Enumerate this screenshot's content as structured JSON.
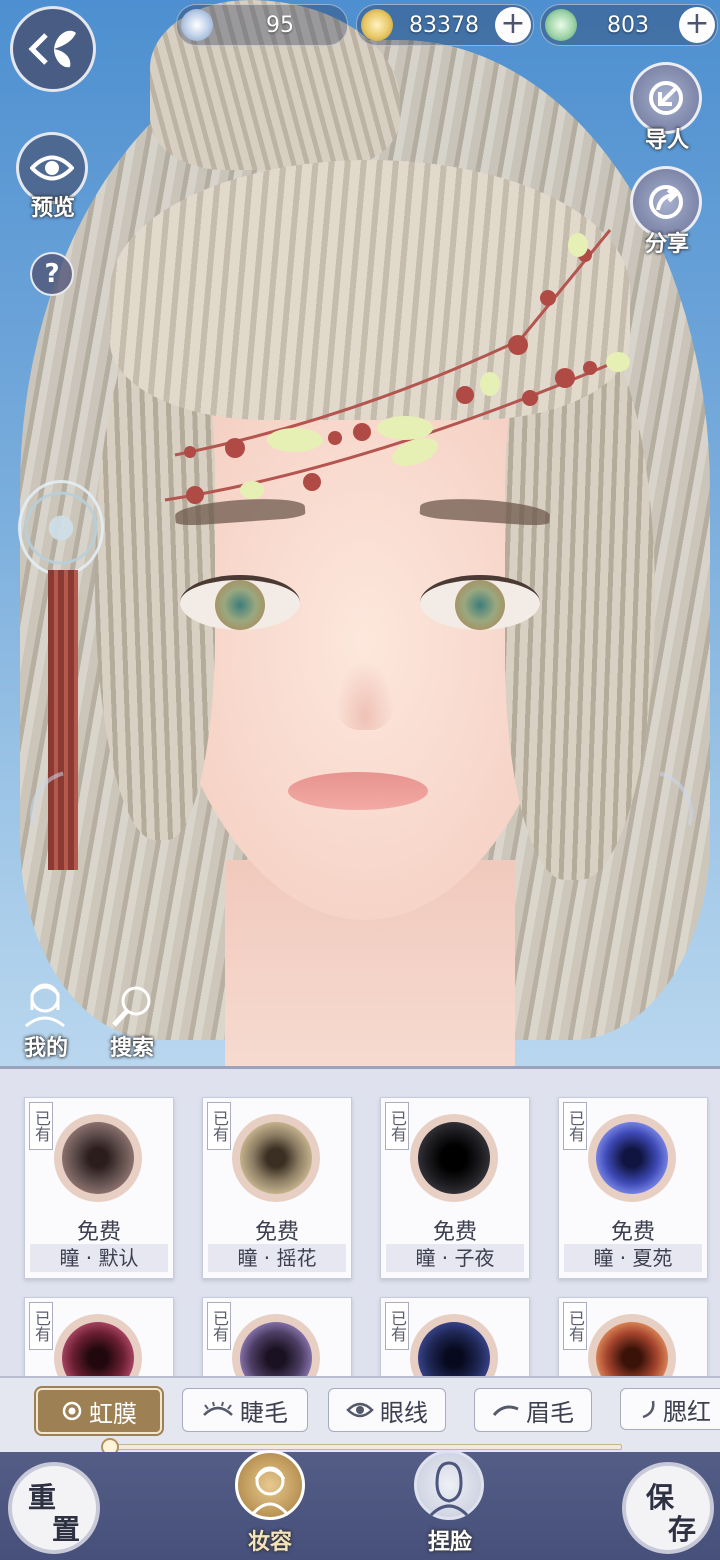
{
  "currencies": [
    {
      "name": "jade",
      "value": "95",
      "has_plus": false,
      "color": "#b9cce6"
    },
    {
      "name": "copper-coin",
      "value": "83378",
      "has_plus": true,
      "color": "#e8c766"
    },
    {
      "name": "token",
      "value": "803",
      "has_plus": true,
      "color": "#9fd4a8"
    }
  ],
  "plus_symbol": "+",
  "left_buttons": {
    "preview": "预览",
    "help_symbol": "?"
  },
  "right_buttons": {
    "import": "导人",
    "share": "分享"
  },
  "bottom_left": {
    "mine": "我的",
    "search": "搜索"
  },
  "items": [
    {
      "tag": "已有",
      "price": "免费",
      "name": "瞳 · 默认",
      "color": "#5a4a48"
    },
    {
      "tag": "已有",
      "price": "免费",
      "name": "瞳 · 摇花",
      "color": "#8a7b63"
    },
    {
      "tag": "已有",
      "price": "免费",
      "name": "瞳 · 子夜",
      "color": "#1e1e22"
    },
    {
      "tag": "已有",
      "price": "免费",
      "name": "瞳 · 夏苑",
      "color": "#3e49b5"
    },
    {
      "tag": "已有",
      "price": "",
      "name": "",
      "color": "#6b1f32"
    },
    {
      "tag": "已有",
      "price": "",
      "name": "",
      "color": "#4c3d63"
    },
    {
      "tag": "已有",
      "price": "",
      "name": "",
      "color": "#1f2755"
    },
    {
      "tag": "已有",
      "price": "",
      "name": "",
      "color": "#a6452e"
    }
  ],
  "tabs": [
    {
      "label": "虹膜",
      "icon": "circle-icon",
      "active": true
    },
    {
      "label": "睫毛",
      "icon": "lash-icon",
      "active": false
    },
    {
      "label": "眼线",
      "icon": "eye-icon",
      "active": false
    },
    {
      "label": "眉毛",
      "icon": "brow-icon",
      "active": false
    },
    {
      "label": "腮红",
      "icon": "blush-icon",
      "active": false
    }
  ],
  "tab_progress": 0.0,
  "bottom_nav": {
    "reset_top": "重",
    "reset_bottom": "置",
    "makeup": "妆容",
    "face": "捏脸",
    "save_top": "保",
    "save_bottom": "存"
  },
  "accent_colors": {
    "active_tab": "#9d8053",
    "bottom_bar": "#4e5780"
  }
}
